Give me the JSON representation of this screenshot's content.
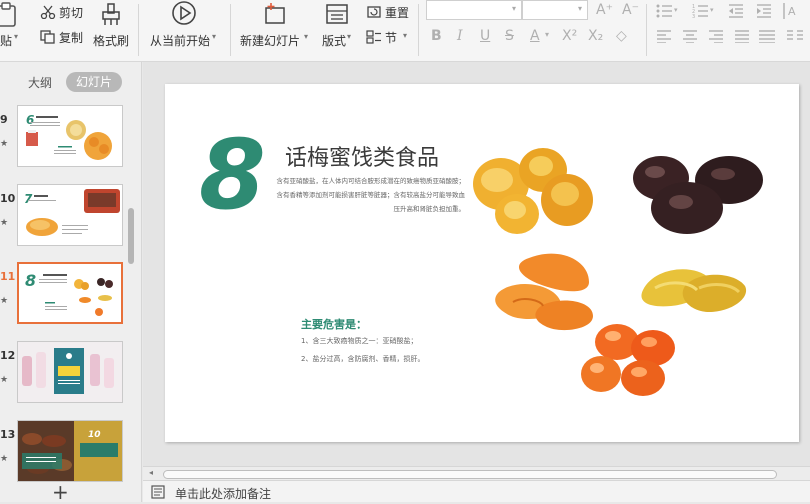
{
  "toolbar": {
    "paste": "贴",
    "cut": "剪切",
    "copy": "复制",
    "format_painter": "格式刷",
    "from_current": "从当前开始",
    "new_slide": "新建幻灯片",
    "layout": "版式",
    "reset": "重置",
    "section": "节"
  },
  "sidebar": {
    "tab_outline": "大纲",
    "tab_slides": "幻灯片",
    "slides": [
      {
        "num": "9"
      },
      {
        "num": "10"
      },
      {
        "num": "11",
        "selected": true
      },
      {
        "num": "12"
      },
      {
        "num": "13"
      }
    ],
    "add": "+"
  },
  "slide": {
    "number": "8",
    "title": "话梅蜜饯类食品",
    "intro": "含有亚硝酸盐，在人体内可结合胺形成潜在的致癌物质亚硝酸胺；含有香精等添加剂可能损害肝脏等脏器；含有较高盐分可能导致血压升高和肾脏负担加重。",
    "subtitle": "主要危害是：",
    "points": [
      "1、含三大致癌物质之一：亚硝酸盐；",
      "2、盐分过高，含防腐剂、香精，损肝。"
    ]
  },
  "notes": {
    "placeholder": "单击此处添加备注"
  },
  "colors": {
    "accent": "#2e8b73",
    "selected": "#e8703a"
  }
}
